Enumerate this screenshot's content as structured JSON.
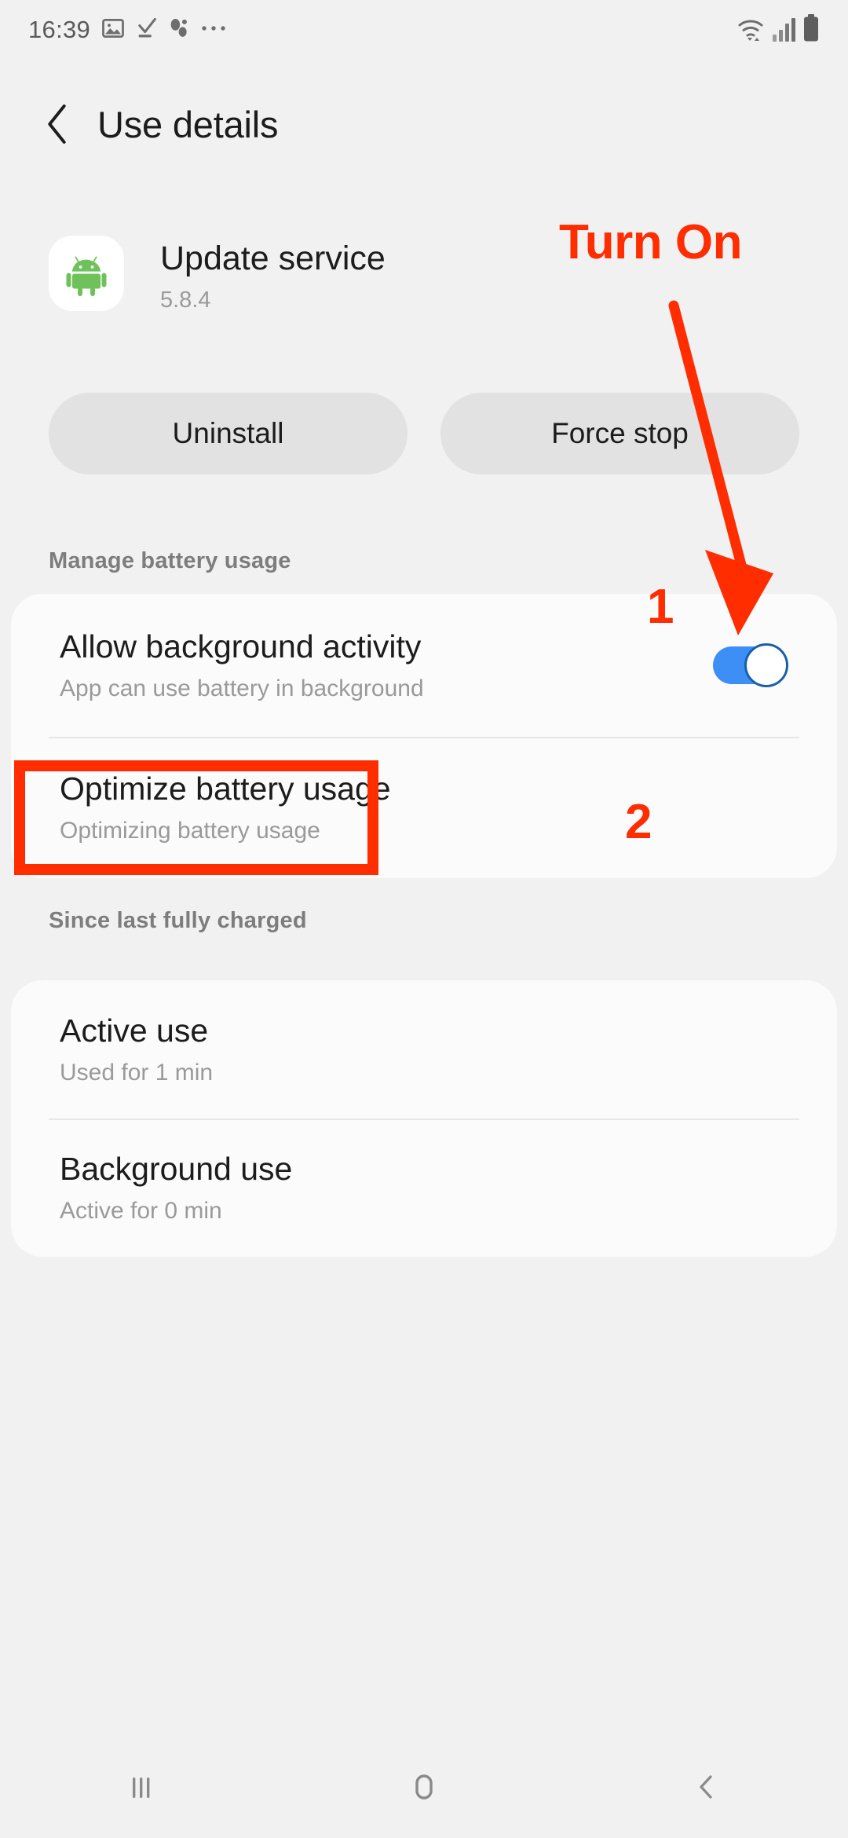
{
  "status_bar": {
    "time": "16:39",
    "left_icons": [
      "image-icon",
      "download-complete-icon",
      "dual-dots-icon",
      "more-icons-ellipsis"
    ],
    "right_icons": [
      "wifi-icon",
      "signal-bars-icon",
      "battery-icon"
    ]
  },
  "header": {
    "back_label": "Back",
    "title": "Use details"
  },
  "app": {
    "icon": "android-robot-icon",
    "name": "Update service",
    "version": "5.8.4"
  },
  "actions": {
    "uninstall_label": "Uninstall",
    "force_stop_label": "Force stop"
  },
  "manage_battery": {
    "section_label": "Manage battery usage",
    "rows": [
      {
        "title": "Allow background activity",
        "subtitle": "App can use battery in background",
        "toggle_state": "on"
      },
      {
        "title": "Optimize battery usage",
        "subtitle": "Optimizing battery usage"
      }
    ]
  },
  "since_last_charged": {
    "section_label": "Since last fully charged",
    "rows": [
      {
        "title": "Active use",
        "subtitle": "Used for 1 min"
      },
      {
        "title": "Background use",
        "subtitle": "Active for 0 min"
      }
    ]
  },
  "annotations": {
    "color": "#ff2d00",
    "callout_text": "Turn On",
    "step_one": "1",
    "step_two": "2",
    "arrow": "down-right-arrow",
    "highlight_rect": "optimize-battery-usage-row"
  },
  "nav_bar": {
    "recents_label": "Recents",
    "home_label": "Home",
    "back_label": "Back"
  },
  "colors": {
    "background": "#f1f1f1",
    "card": "#fbfbfb",
    "toggle_on": "#3d8ef5",
    "accent_red": "#ff2d00",
    "button_bg": "#e2e2e2"
  }
}
